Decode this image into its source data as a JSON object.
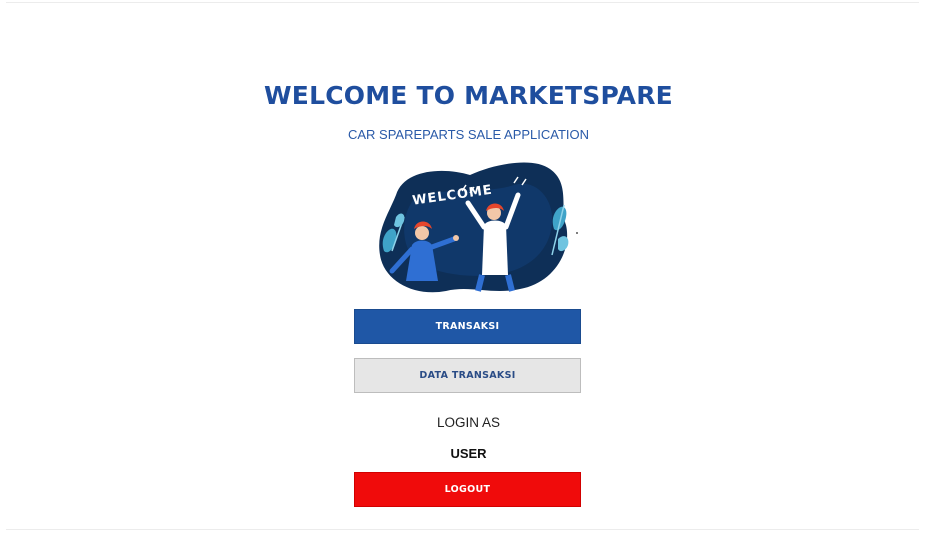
{
  "header": {
    "title": "WELCOME TO MARKETSPARE",
    "subtitle": "CAR SPAREPARTS SALE APPLICATION"
  },
  "illustration": {
    "name": "welcome-illustration",
    "text": "WELCOME"
  },
  "actions": {
    "transaksi_label": "TRANSAKSI",
    "data_transaksi_label": "DATA TRANSAKSI",
    "logout_label": "LOGOUT"
  },
  "session": {
    "login_as_label": "LOGIN AS",
    "role": "USER"
  },
  "colors": {
    "primary": "#1f57a6",
    "secondary": "#e6e6e6",
    "danger": "#f00b0b",
    "title": "#1f4e9e"
  }
}
